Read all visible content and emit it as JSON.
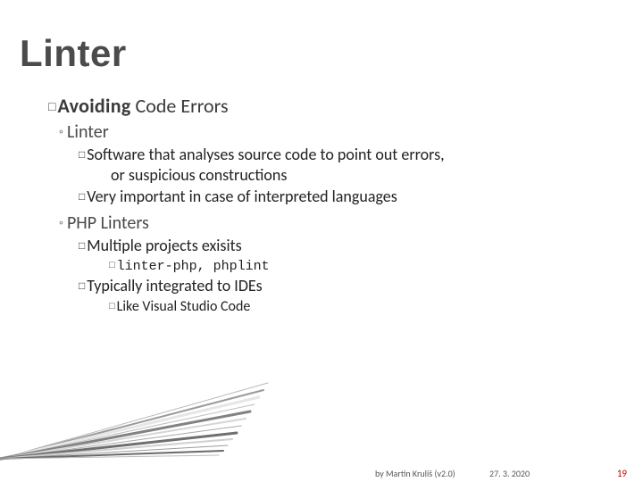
{
  "title": "Linter",
  "h1": {
    "word1": "Avoiding",
    "rest": " Code Errors"
  },
  "sec1": {
    "heading": "Linter",
    "b1a": "Software that analyses source code to point out errors,",
    "b1b": "or suspicious constructions",
    "b2": "Very important in case of interpreted languages"
  },
  "sec2": {
    "heading": "PHP Linters",
    "b1": "Multiple projects exisits",
    "b1s": "linter-php, phplint",
    "b2": "Typically integrated to IDEs",
    "b2s": "Like Visual Studio Code"
  },
  "footer": {
    "by": "by Martin Kruliš (v2.0)",
    "date": "27. 3. 2020",
    "page": "19"
  }
}
